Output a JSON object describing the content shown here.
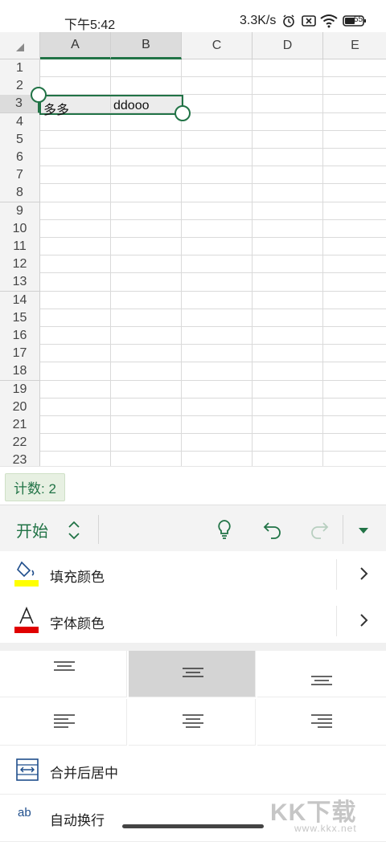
{
  "status_bar": {
    "time": "下午5:42",
    "network_speed": "3.3K/s",
    "battery": "55"
  },
  "sheet": {
    "columns": [
      "A",
      "B",
      "C",
      "D",
      "E"
    ],
    "rows": [
      "1",
      "2",
      "3",
      "4",
      "5",
      "6",
      "7",
      "8",
      "9",
      "10",
      "11",
      "12",
      "13",
      "14",
      "15",
      "16",
      "17",
      "18",
      "19",
      "20",
      "21",
      "22",
      "23"
    ],
    "selected_columns": [
      "A",
      "B"
    ],
    "selected_row": "3",
    "cells": {
      "A3": "多多",
      "B3": "ddooo"
    }
  },
  "status": {
    "count_label": "计数: 2"
  },
  "toolbar": {
    "tab_label": "开始",
    "icons": [
      "chevron-updown-icon",
      "lightbulb-icon",
      "undo-icon",
      "redo-icon",
      "dropdown-icon"
    ]
  },
  "menu": {
    "fill_color": {
      "label": "填充颜色",
      "swatch": "#ffff00"
    },
    "font_color": {
      "label": "字体颜色",
      "swatch": "#e00000"
    },
    "merge_center": {
      "label": "合并后居中"
    },
    "wrap_text": {
      "label": "自动换行"
    }
  },
  "alignment": {
    "vertical": [
      "top",
      "middle",
      "bottom"
    ],
    "vertical_selected": "middle",
    "horizontal": [
      "left",
      "center",
      "right"
    ]
  },
  "watermark": {
    "text": "KK下载",
    "url": "www.kkx.net"
  },
  "colors": {
    "accent": "#217346",
    "header_bg": "#f3f3f3",
    "selected_header_bg": "#dcdcdc"
  }
}
